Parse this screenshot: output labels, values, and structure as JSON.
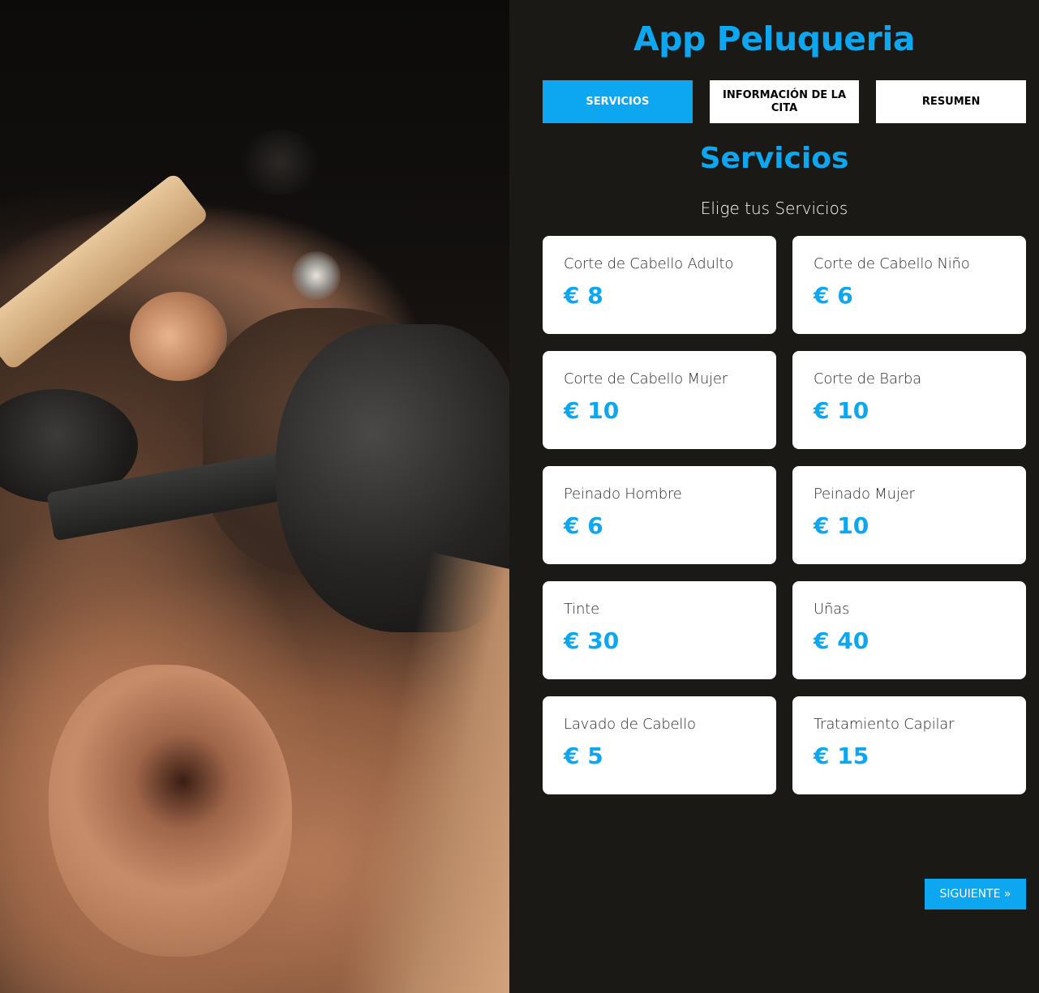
{
  "app": {
    "title": "App Peluqueria"
  },
  "hero": {
    "image": "barber-shaving-beard-photo"
  },
  "tabs": [
    {
      "label": "Servicios",
      "active": true
    },
    {
      "label": "Información de la cita",
      "active": false
    },
    {
      "label": "Resumen",
      "active": false
    }
  ],
  "section": {
    "title": "Servicios",
    "subtitle": "Elige tus Servicios"
  },
  "services": [
    {
      "name": "Corte de Cabello Adulto",
      "price": "€ 8"
    },
    {
      "name": "Corte de Cabello Niño",
      "price": "€ 6"
    },
    {
      "name": "Corte de Cabello Mujer",
      "price": "€ 10"
    },
    {
      "name": "Corte de Barba",
      "price": "€ 10"
    },
    {
      "name": "Peinado Hombre",
      "price": "€ 6"
    },
    {
      "name": "Peinado Mujer",
      "price": "€ 10"
    },
    {
      "name": "Tinte",
      "price": "€ 30"
    },
    {
      "name": "Uñas",
      "price": "€ 40"
    },
    {
      "name": "Lavado de Cabello",
      "price": "€ 5"
    },
    {
      "name": "Tratamiento Capilar",
      "price": "€ 15"
    }
  ],
  "navigation": {
    "next_label": "Siguiente »"
  },
  "colors": {
    "accent": "#0da6f1",
    "background": "#1a1916",
    "card": "#ffffff"
  }
}
